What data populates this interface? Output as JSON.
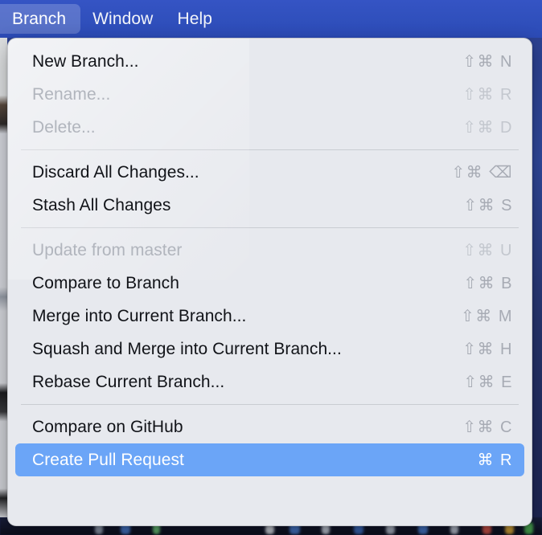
{
  "menubar": {
    "items": [
      {
        "label": "Branch",
        "active": true
      },
      {
        "label": "Window",
        "active": false
      },
      {
        "label": "Help",
        "active": false
      }
    ]
  },
  "menu": {
    "title": "Branch",
    "groups": [
      {
        "items": [
          {
            "label": "New Branch...",
            "shortcut": "⇧⌘ N",
            "state": "enabled"
          },
          {
            "label": "Rename...",
            "shortcut": "⇧⌘ R",
            "state": "disabled"
          },
          {
            "label": "Delete...",
            "shortcut": "⇧⌘ D",
            "state": "disabled"
          }
        ]
      },
      {
        "items": [
          {
            "label": "Discard All Changes...",
            "shortcut": "⇧⌘ ⌫",
            "state": "enabled"
          },
          {
            "label": "Stash All Changes",
            "shortcut": "⇧⌘ S",
            "state": "enabled"
          }
        ]
      },
      {
        "items": [
          {
            "label": "Update from master",
            "shortcut": "⇧⌘ U",
            "state": "disabled"
          },
          {
            "label": "Compare to Branch",
            "shortcut": "⇧⌘ B",
            "state": "enabled"
          },
          {
            "label": "Merge into Current Branch...",
            "shortcut": "⇧⌘ M",
            "state": "enabled"
          },
          {
            "label": "Squash and Merge into Current Branch...",
            "shortcut": "⇧⌘ H",
            "state": "enabled"
          },
          {
            "label": "Rebase Current Branch...",
            "shortcut": "⇧⌘ E",
            "state": "enabled"
          }
        ]
      },
      {
        "items": [
          {
            "label": "Compare on GitHub",
            "shortcut": "⇧⌘ C",
            "state": "enabled"
          },
          {
            "label": "Create Pull Request",
            "shortcut": "⌘ R",
            "state": "highlighted"
          }
        ]
      }
    ]
  },
  "colors": {
    "menubar_blue": "#3050bd",
    "panel_bg": "#e7e9ee",
    "highlight_blue": "#6ba5f7",
    "label_text": "#111318",
    "disabled_text": "#b1b5bd",
    "shortcut_text": "#a7abb4"
  }
}
